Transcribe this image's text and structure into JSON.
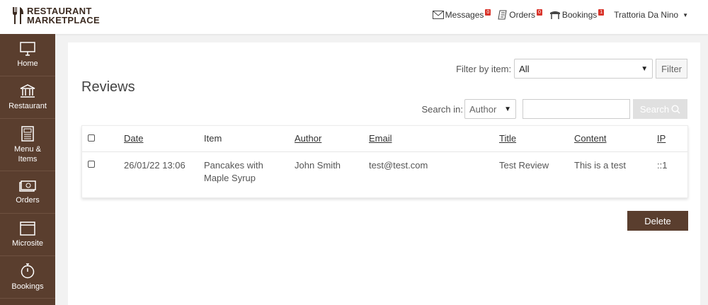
{
  "header": {
    "logo_line1": "RESTAURANT",
    "logo_line2": "MARKETPLACE",
    "nav": {
      "messages_label": "Messages",
      "messages_count": "0",
      "orders_label": "Orders",
      "orders_count": "0",
      "bookings_label": "Bookings",
      "bookings_count": "1",
      "user_name": "Trattoria Da Nino"
    }
  },
  "sidebar": {
    "items": [
      {
        "label": "Home",
        "icon": "monitor-icon"
      },
      {
        "label": "Restaurant",
        "icon": "bank-icon"
      },
      {
        "label": "Menu &\nItems",
        "icon": "menu-icon"
      },
      {
        "label": "Orders",
        "icon": "cash-icon"
      },
      {
        "label": "Microsite",
        "icon": "browser-window-icon"
      },
      {
        "label": "Bookings",
        "icon": "stopwatch-icon"
      }
    ]
  },
  "main": {
    "title": "Reviews",
    "filter": {
      "label": "Filter by item:",
      "selected": "All",
      "button": "Filter"
    },
    "search": {
      "label": "Search in:",
      "selected": "Author",
      "input_value": "",
      "button": "Search"
    },
    "table": {
      "columns": [
        "Date",
        "Item",
        "Author",
        "Email",
        "Title",
        "Content",
        "IP"
      ],
      "rows": [
        {
          "date": "26/01/22 13:06",
          "item": "Pancakes with Maple Syrup",
          "author": "John Smith",
          "email": "test@test.com",
          "title": "Test Review",
          "content": "This is a test",
          "ip": "::1"
        }
      ]
    },
    "delete_button": "Delete"
  },
  "colors": {
    "brand": "#5a3e2e",
    "badge": "#d9342b",
    "panel": "#ffffff"
  }
}
